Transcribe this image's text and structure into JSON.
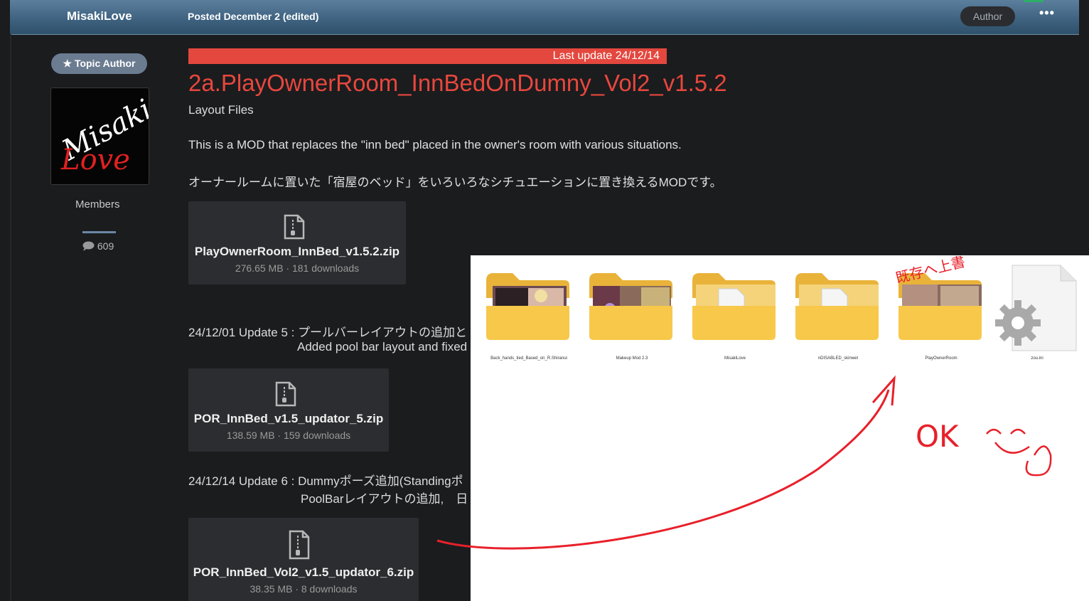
{
  "header": {
    "username": "MisakiLove",
    "posted": "Posted December 2 (edited)",
    "author_badge": "Author",
    "more": "•••"
  },
  "sidebar": {
    "topic_author_badge": "★ Topic Author",
    "avatar_text_line1": "Misaki",
    "avatar_text_line2": "Love",
    "role": "Members",
    "post_count": "609"
  },
  "post": {
    "last_update": "Last update 24/12/14",
    "title": "2a.PlayOwnerRoom_InnBedOnDumny_Vol2_v1.5.2",
    "subtitle": "Layout Files",
    "description_en": "This is a MOD that replaces the \"inn bed\" placed in the owner's room with various situations.",
    "description_jp": "オーナールームに置いた「宿屋のベッド」をいろいろなシチュエーションに置き換えるMODです。",
    "attachments": [
      {
        "name": "PlayOwnerRoom_InnBed_v1.5.2.zip",
        "meta": "276.65 MB · 181 downloads"
      },
      {
        "name": "POR_InnBed_v1.5_updator_5.zip",
        "meta": "138.59 MB · 159 downloads"
      },
      {
        "name": "POR_InnBed_Vol2_v1.5_updator_6.zip",
        "meta": "38.35 MB · 8 downloads"
      }
    ],
    "update5_line1": "24/12/01 Update 5 : プールバーレイアウトの追加と",
    "update5_line2": "Added pool bar layout and fixed",
    "update6_line1": "24/12/14 Update 6 : Dummyポーズ追加(Standingポ",
    "update6_line2": "PoolBarレイアウトの追加,　日"
  },
  "explorer": {
    "items": [
      {
        "label": "Back_hands_tied_Based_on_R.Shiranui",
        "kind": "folder-photo"
      },
      {
        "label": "Makeup Mod 2.3",
        "kind": "folder-photo"
      },
      {
        "label": "MisakiLove",
        "kind": "folder-doc"
      },
      {
        "label": "nDISABLED_skinwet",
        "kind": "folder-doc"
      },
      {
        "label": "PlayOwnerRoom",
        "kind": "folder-photo"
      },
      {
        "label": "zou.ini",
        "kind": "ini-file"
      }
    ]
  },
  "annotations": {
    "ok_text": "OK",
    "handwritten_note": "既存へ上書"
  },
  "colors": {
    "accent_red": "#e8473d",
    "header_blue": "#3f6381",
    "badge_gray": "#6b7c91",
    "annotation_red": "#e8202a",
    "folder_yellow": "#f7c84a"
  }
}
